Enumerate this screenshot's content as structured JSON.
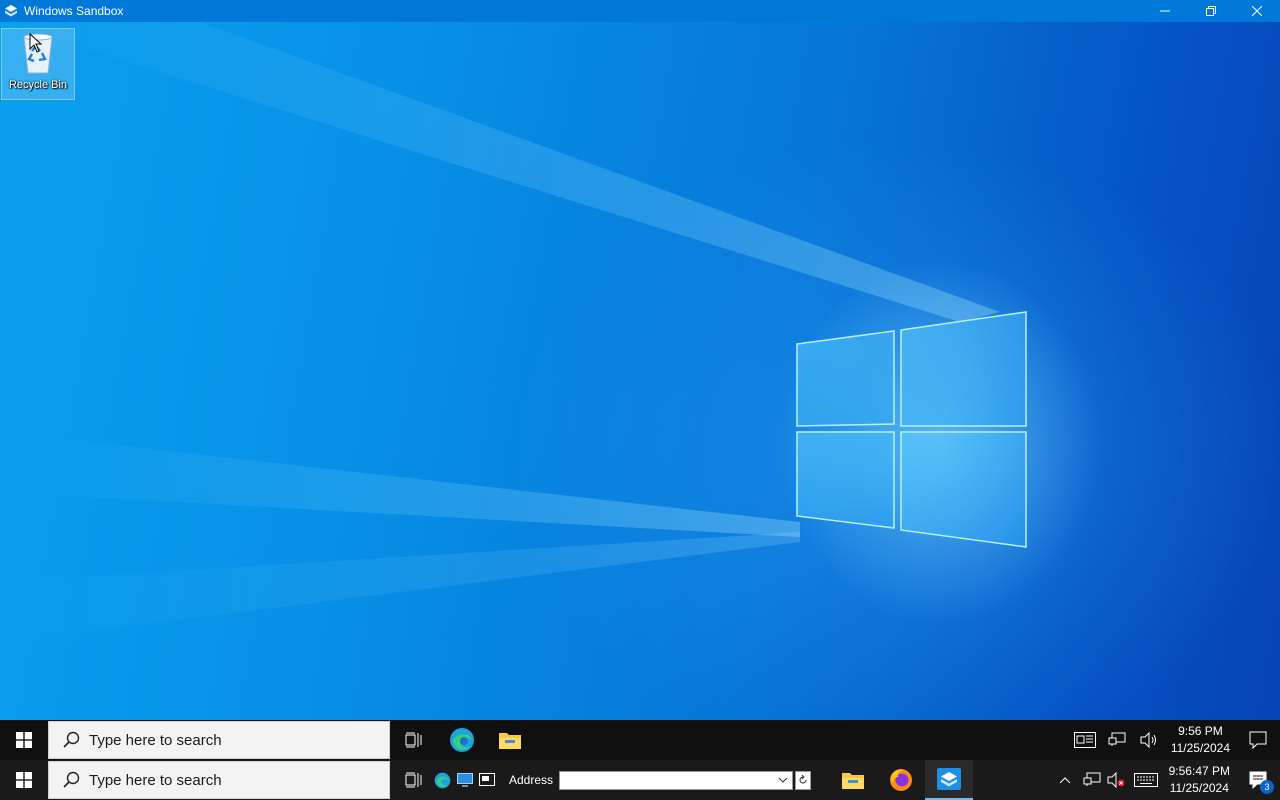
{
  "window": {
    "title": "Windows Sandbox"
  },
  "desktop": {
    "icons": [
      {
        "label": "Recycle Bin",
        "icon": "recycle-bin-icon"
      }
    ]
  },
  "taskbar_top": {
    "search_placeholder": "Type here to search",
    "apps": [
      "task-view-icon",
      "edge-icon",
      "file-explorer-icon"
    ],
    "clock": {
      "time": "9:56 PM",
      "date": "11/25/2024"
    }
  },
  "taskbar_bottom": {
    "search_placeholder": "Type here to search",
    "address_label": "Address",
    "address_value": "",
    "apps": [
      "file-explorer-icon",
      "firefox-icon",
      "windows-sandbox-icon"
    ],
    "clock": {
      "time": "9:56:47 PM",
      "date": "11/25/2024"
    },
    "notification_count": "3"
  },
  "colors": {
    "accent": "#0078d7",
    "taskbar": "#101010"
  }
}
